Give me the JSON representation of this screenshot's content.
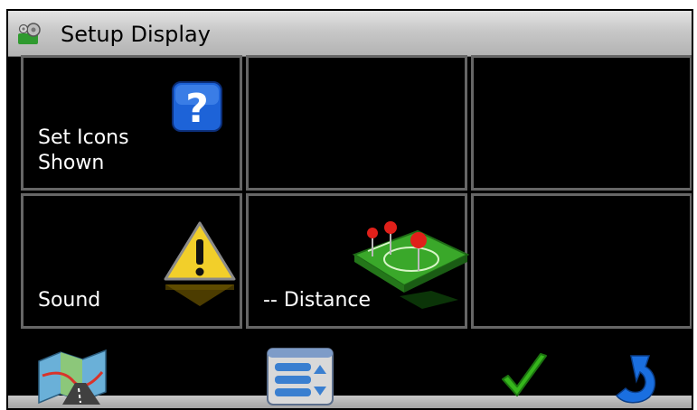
{
  "window": {
    "title": "Setup Display"
  },
  "tiles": [
    {
      "label_line1": "Set Icons",
      "label_line2": "Shown",
      "icon": "help-question-icon"
    },
    {
      "label": "",
      "icon": ""
    },
    {
      "label": "",
      "icon": ""
    },
    {
      "label": "Sound",
      "icon": "warning-triangle-icon"
    },
    {
      "label": "-- Distance",
      "icon": "map-pins-icon"
    },
    {
      "label": "",
      "icon": ""
    }
  ],
  "toolbar": {
    "map_button_icon": "map-icon",
    "list_button_icon": "list-menu-icon",
    "ok_button_icon": "checkmark-icon",
    "back_button_icon": "back-arrow-icon"
  },
  "colors": {
    "accent_blue": "#1a6fe0",
    "check_green": "#36b61c",
    "tile_border": "#666666"
  }
}
